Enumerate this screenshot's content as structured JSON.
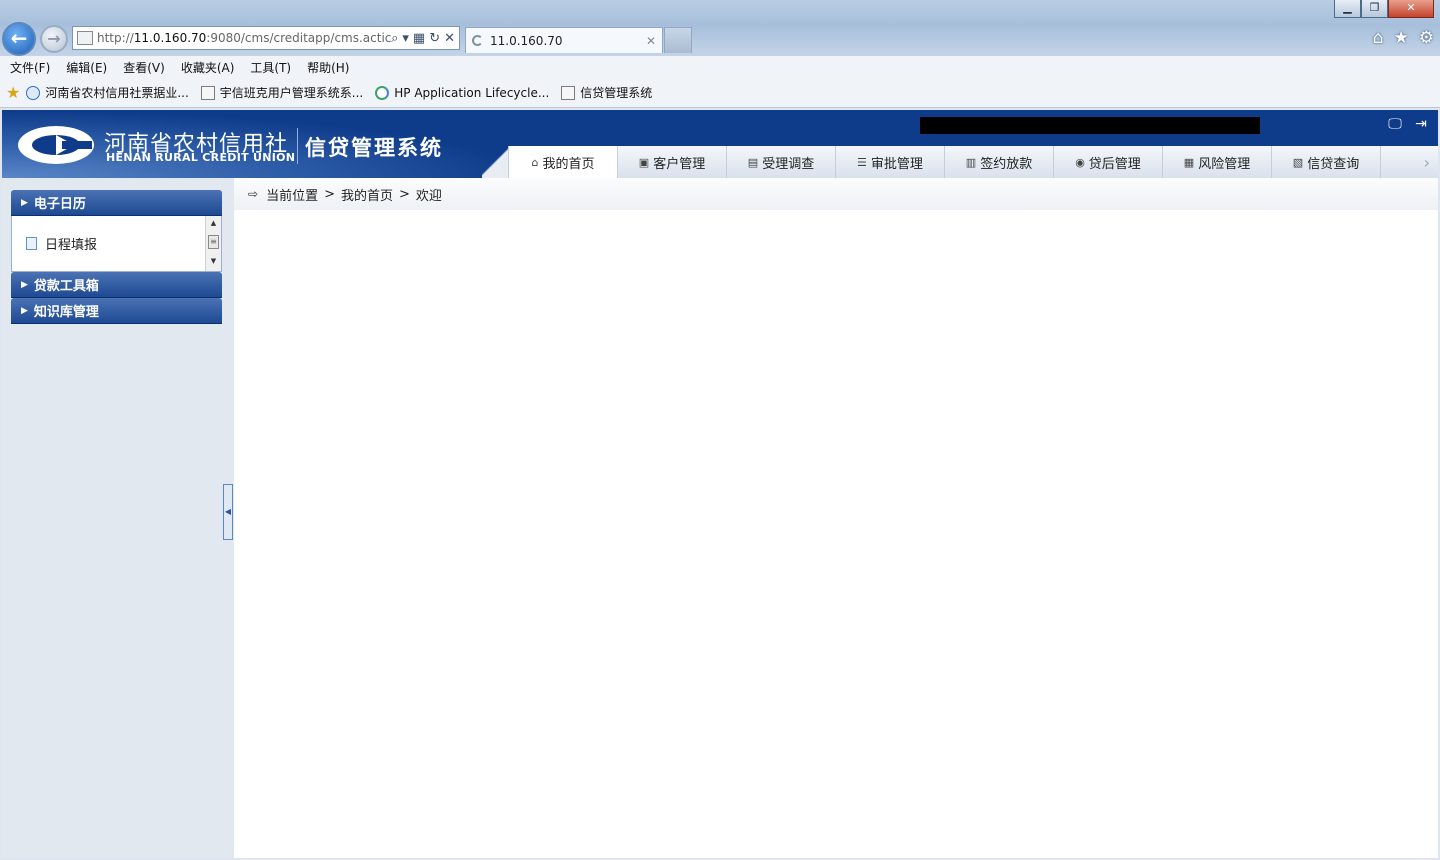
{
  "browser": {
    "address_prefix": "http://",
    "address_host": "11.0.160.70",
    "address_rest": ":9080/cms/creditapp/cms.actic",
    "tab_title": "11.0.160.70",
    "menu": [
      "文件(F)",
      "编辑(E)",
      "查看(V)",
      "收藏夹(A)",
      "工具(T)",
      "帮助(H)"
    ],
    "favorites": [
      {
        "label": "河南省农村信用社票据业...",
        "icon": "ie-page-icon"
      },
      {
        "label": "宇信班克用户管理系统系...",
        "icon": "page-icon"
      },
      {
        "label": "HP Application Lifecycle...",
        "icon": "hp-alm-icon"
      },
      {
        "label": "信贷管理系统",
        "icon": "page-icon"
      }
    ]
  },
  "header": {
    "brand_cn": "河南省农村信用社",
    "brand_en": "HENAN RURAL CREDIT UNION",
    "system_name": "信贷管理系统"
  },
  "nav": {
    "tabs": [
      {
        "label": "我的首页",
        "icon": "home-icon",
        "glyph": "⌂",
        "active": true
      },
      {
        "label": "客户管理",
        "icon": "customer-icon",
        "glyph": "▣",
        "active": false
      },
      {
        "label": "受理调查",
        "icon": "survey-icon",
        "glyph": "▤",
        "active": false
      },
      {
        "label": "审批管理",
        "icon": "approval-icon",
        "glyph": "☰",
        "active": false
      },
      {
        "label": "签约放款",
        "icon": "contract-icon",
        "glyph": "▥",
        "active": false
      },
      {
        "label": "贷后管理",
        "icon": "post-loan-icon",
        "glyph": "◉",
        "active": false
      },
      {
        "label": "风险管理",
        "icon": "risk-icon",
        "glyph": "▦",
        "active": false
      },
      {
        "label": "信贷查询",
        "icon": "query-icon",
        "glyph": "▧",
        "active": false
      }
    ]
  },
  "sidebar": {
    "sections": [
      {
        "label": "电子日历"
      },
      {
        "label": "贷款工具箱"
      },
      {
        "label": "知识库管理"
      }
    ],
    "calendar_items": [
      {
        "label": "日程填报"
      }
    ]
  },
  "breadcrumb": {
    "items": [
      "当前位置",
      "我的首页",
      "欢迎"
    ],
    "separator": ">"
  },
  "colors": {
    "header_blue": "#0f3c8a",
    "accordion_blue": "#1e4a93"
  }
}
